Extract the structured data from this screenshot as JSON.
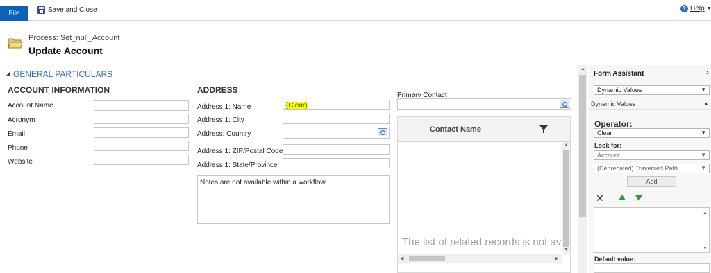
{
  "ribbon": {
    "file_label": "File",
    "save_close_label": "Save and Close",
    "help_label": "Help"
  },
  "header": {
    "process_label": "Process: Set_null_Account",
    "title": "Update Account"
  },
  "section": {
    "title": "GENERAL PARTICULARS"
  },
  "account_info": {
    "title": "ACCOUNT INFORMATION",
    "fields": [
      {
        "label": "Account Name",
        "value": ""
      },
      {
        "label": "Acronym",
        "value": ""
      },
      {
        "label": "Email",
        "value": ""
      },
      {
        "label": "Phone",
        "value": ""
      },
      {
        "label": "Website",
        "value": ""
      }
    ]
  },
  "address": {
    "title": "ADDRESS",
    "fields": [
      {
        "label": "Address 1: Name",
        "value": "{Clear}"
      },
      {
        "label": "Address 1: City",
        "value": ""
      },
      {
        "label": "Address: Country",
        "value": ""
      },
      {
        "label": "Address 1: ZIP/Postal Code",
        "value": ""
      },
      {
        "label": "Address 1: State/Province",
        "value": ""
      }
    ],
    "notes": "Notes are not available within a workflow"
  },
  "contact": {
    "label": "Primary Contact",
    "value": "",
    "grid_column": "Contact Name",
    "empty_message": "The list of related records is not available"
  },
  "form_assistant": {
    "title": "Form Assistant",
    "mode_select": "Dynamic Values",
    "section_label": "Dynamic Values",
    "operator_label": "Operator:",
    "operator_value": "Clear",
    "look_for_label": "Look for:",
    "look_for_entity": "Account",
    "look_for_path": "(Deprecated) Traversed Path",
    "add_label": "Add",
    "default_value_label": "Default value:"
  },
  "colors": {
    "file_button": "#1160b7",
    "section_title": "#3b6bb5",
    "clear_highlight": "#ffff00"
  }
}
